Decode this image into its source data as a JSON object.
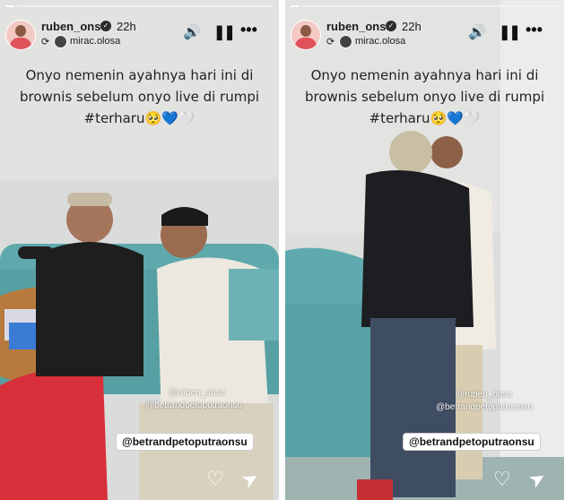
{
  "stories": [
    {
      "username": "ruben_onsu",
      "time": "22h",
      "verified_glyph": "✓",
      "repost_glyph": "⟳",
      "music_user": "mirac.olosa",
      "caption_line1": "Onyo nemenin ayahnya hari ini di",
      "caption_line2": "brownis sebelum onyo live di  rumpi",
      "caption_line3": "#terharu🥺💙🤍",
      "mention_small1": "@ruben_onsu",
      "mention_small2": "@betrandpetoputraonsu",
      "mention_tag": "@betrandpetoputraonsu",
      "icons": {
        "sound": "🔊",
        "pause": "❚❚",
        "more": "•••",
        "like": "♡",
        "share": "➤"
      }
    },
    {
      "username": "ruben_onsu",
      "time": "22h",
      "verified_glyph": "✓",
      "repost_glyph": "⟳",
      "music_user": "mirac.olosa",
      "caption_line1": "Onyo nemenin ayahnya hari ini di",
      "caption_line2": "brownis sebelum onyo live di  rumpi",
      "caption_line3": "#terharu🥺💙🤍",
      "mention_small1": "@ruben_onsu",
      "mention_small2": "@betrandpetoputraonsu",
      "mention_tag": "@betrandpetoputraonsu",
      "icons": {
        "sound": "🔊",
        "pause": "❚❚",
        "more": "•••",
        "like": "♡",
        "share": "➤"
      }
    }
  ]
}
